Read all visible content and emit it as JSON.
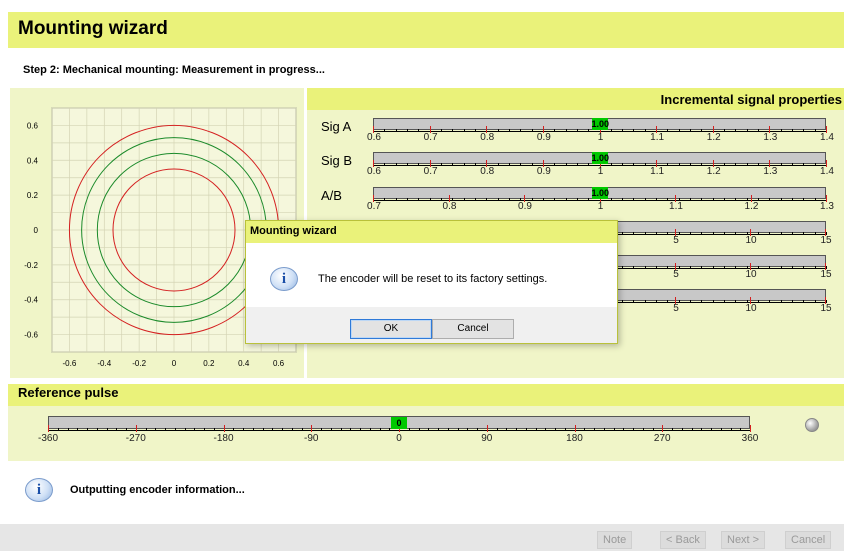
{
  "header": {
    "title": "Mounting wizard"
  },
  "step": {
    "text": "Step 2: Mechanical mounting: Measurement in progress..."
  },
  "plot": {
    "x_ticks": [
      "-0.6",
      "-0.4",
      "-0.2",
      "0",
      "0.2",
      "0.4",
      "0.6"
    ],
    "y_ticks": [
      "0.6",
      "0.4",
      "0.2",
      "0",
      "-0.2",
      "-0.4",
      "-0.6"
    ],
    "circle_colors": {
      "outer": "#d42020",
      "inner": "#1b8a2a"
    }
  },
  "props": {
    "title": "Incremental signal properties",
    "rows": [
      {
        "label": "Sig A",
        "value": "1.00",
        "ticks": [
          "0.6",
          "0.7",
          "0.8",
          "0.9",
          "1",
          "1.1",
          "1.2",
          "1.3",
          "1.4"
        ]
      },
      {
        "label": "Sig B",
        "value": "1.00",
        "ticks": [
          "0.6",
          "0.7",
          "0.8",
          "0.9",
          "1",
          "1.1",
          "1.2",
          "1.3",
          "1.4"
        ]
      },
      {
        "label": "A/B",
        "value": "1.00",
        "ticks": [
          "0.7",
          "0.8",
          "0.9",
          "1",
          "1.1",
          "1.2",
          "1.3"
        ]
      },
      {
        "label": "",
        "value": "",
        "ticks": [
          "5",
          "10",
          "15"
        ]
      },
      {
        "label": "",
        "value": "",
        "ticks": [
          "5",
          "10",
          "15"
        ]
      },
      {
        "label": "",
        "value": "",
        "ticks": [
          "5",
          "10",
          "15"
        ]
      }
    ]
  },
  "reference": {
    "title": "Reference pulse",
    "value": "0",
    "ticks": [
      "-360",
      "-270",
      "-180",
      "-90",
      "0",
      "90",
      "180",
      "270",
      "360"
    ]
  },
  "status": {
    "text": "Outputting encoder information..."
  },
  "footer": {
    "note": "Note",
    "back": "< Back",
    "next": "Next >",
    "cancel": "Cancel"
  },
  "dialog": {
    "title": "Mounting wizard",
    "message": "The encoder will be reset to its factory settings.",
    "ok": "OK",
    "cancel": "Cancel"
  }
}
